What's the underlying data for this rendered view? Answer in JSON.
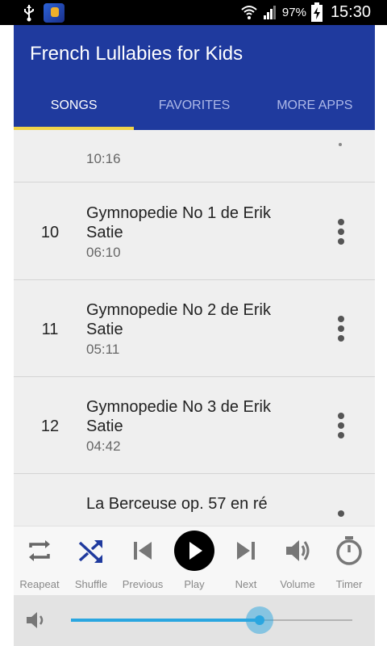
{
  "status_bar": {
    "icons": [
      "usb-icon",
      "app-notification-icon",
      "wifi-icon",
      "signal-icon",
      "battery-charging-icon"
    ],
    "battery": "97%",
    "time": "15:30"
  },
  "app": {
    "title": "French Lullabies for Kids",
    "tabs": [
      {
        "label": "SONGS",
        "active": true
      },
      {
        "label": "FAVORITES",
        "active": false
      },
      {
        "label": "MORE APPS",
        "active": false
      }
    ],
    "accent_color": "#1f3a9e",
    "indicator_color": "#f0d44a"
  },
  "songs": [
    {
      "number": "",
      "title": "",
      "duration": "10:16"
    },
    {
      "number": "10",
      "title": "Gymnopedie No 1 de Erik Satie",
      "duration": "06:10"
    },
    {
      "number": "11",
      "title": "Gymnopedie No 2 de Erik Satie",
      "duration": "05:11"
    },
    {
      "number": "12",
      "title": "Gymnopedie No 3 de Erik Satie",
      "duration": "04:42"
    },
    {
      "number": "",
      "title": "La Berceuse op. 57 en ré",
      "duration": ""
    }
  ],
  "controls": [
    {
      "label": "Reapeat",
      "icon": "repeat-icon"
    },
    {
      "label": "Shuffle",
      "icon": "shuffle-icon",
      "active": true
    },
    {
      "label": "Previous",
      "icon": "previous-icon"
    },
    {
      "label": "Play",
      "icon": "play-icon"
    },
    {
      "label": "Next",
      "icon": "next-icon"
    },
    {
      "label": "Volume",
      "icon": "volume-icon"
    },
    {
      "label": "Timer",
      "icon": "timer-icon"
    }
  ],
  "volume_slider": {
    "icon": "volume-icon",
    "level": 0.67
  }
}
